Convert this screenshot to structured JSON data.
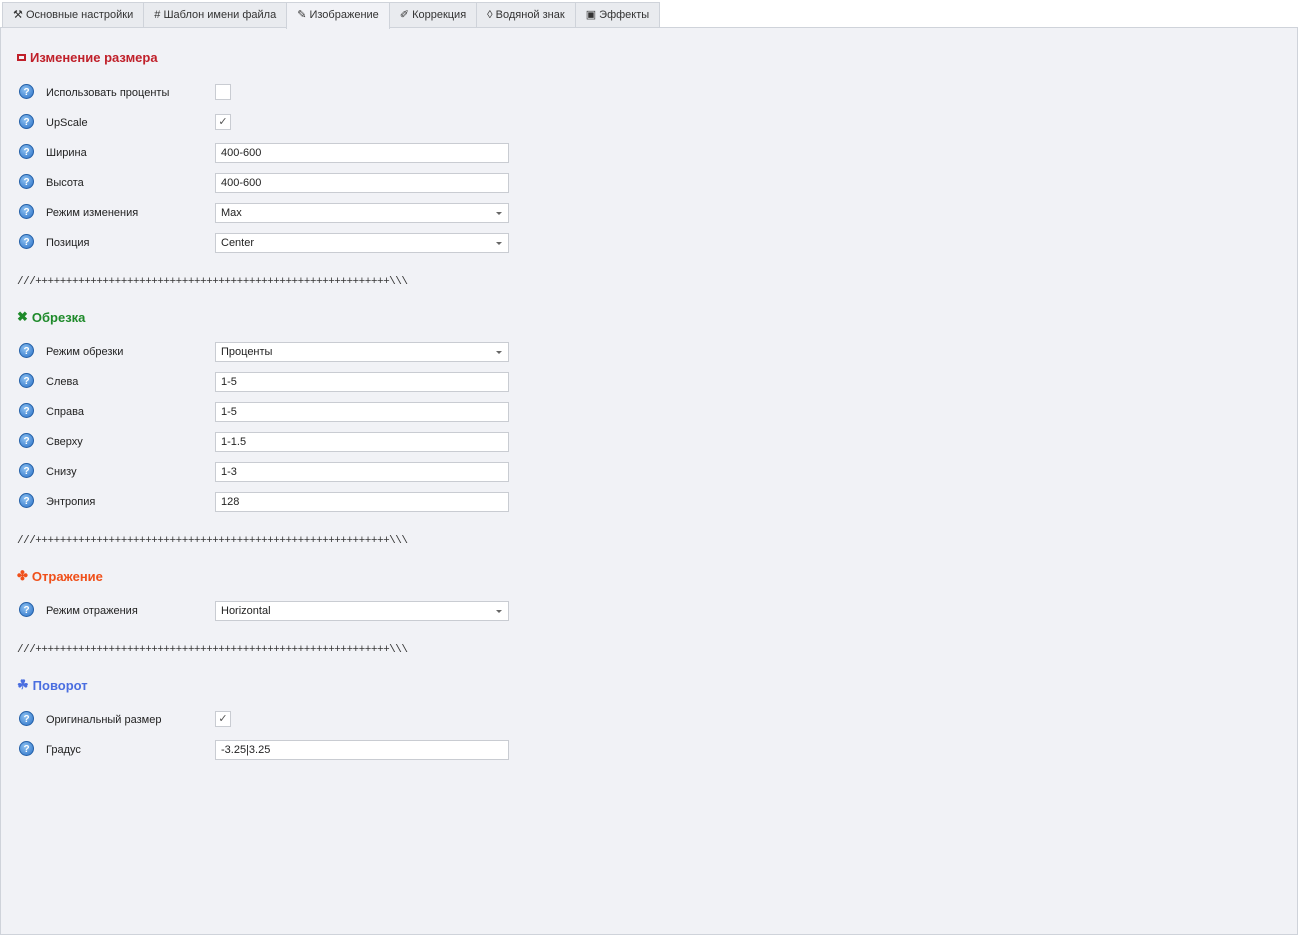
{
  "tabs": [
    {
      "label": "Основные настройки",
      "icon": "tools-icon",
      "glyph": "⚒"
    },
    {
      "label": "Шаблон имени файла",
      "icon": "hash-icon",
      "glyph": "#"
    },
    {
      "label": "Изображение",
      "icon": "pin-icon",
      "glyph": "✎"
    },
    {
      "label": "Коррекция",
      "icon": "pencil-icon",
      "glyph": "✐"
    },
    {
      "label": "Водяной знак",
      "icon": "drop-icon",
      "glyph": "◊"
    },
    {
      "label": "Эффекты",
      "icon": "effects-icon",
      "glyph": "▣"
    }
  ],
  "separator": "///++++++++++++++++++++++++++++++++++++++++++++++++++++++++++\\\\\\",
  "resize": {
    "title": "Изменение размера",
    "color": "#c0202a",
    "use_percent": "Использовать проценты",
    "upscale": "UpScale",
    "upscale_check": "✓",
    "width": "Ширина",
    "width_value": "400-600",
    "height": "Высота",
    "height_value": "400-600",
    "mode": "Режим изменения",
    "mode_value": "Max",
    "position": "Позиция",
    "position_value": "Center"
  },
  "crop": {
    "title": "Обрезка",
    "color": "#1e8a2a",
    "mode": "Режим обрезки",
    "mode_value": "Проценты",
    "left": "Слева",
    "left_value": "1-5",
    "right": "Справа",
    "right_value": "1-5",
    "top": "Сверху",
    "top_value": "1-1.5",
    "bottom": "Снизу",
    "bottom_value": "1-3",
    "entropy": "Энтропия",
    "entropy_value": "128"
  },
  "flip": {
    "title": "Отражение",
    "color": "#f0501a",
    "mode": "Режим отражения",
    "mode_value": "Horizontal"
  },
  "rotate": {
    "title": "Поворот",
    "color": "#4a6ee0",
    "original_size": "Оригинальный размер",
    "original_check": "✓",
    "degree": "Градус",
    "degree_value": "-3.25|3.25"
  },
  "help_glyph": "?"
}
